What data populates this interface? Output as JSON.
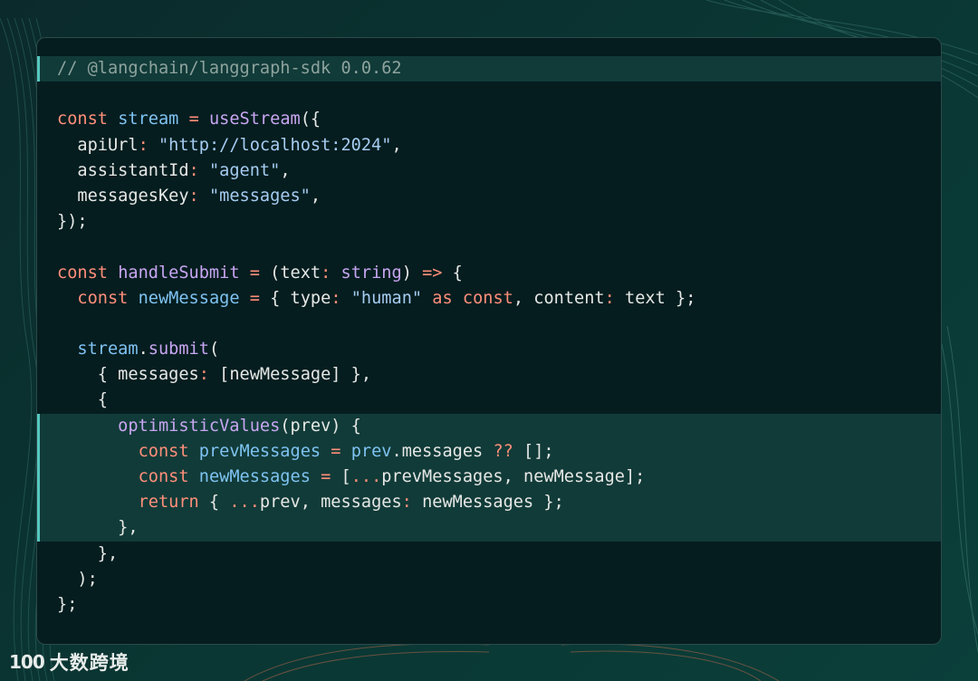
{
  "code_lines": [
    {
      "highlight": true,
      "tokens": [
        {
          "t": "// @langchain/langgraph-sdk 0.0.62",
          "c": "com"
        }
      ]
    },
    {
      "highlight": false,
      "tokens": []
    },
    {
      "highlight": false,
      "tokens": [
        {
          "t": "const",
          "c": "kw"
        },
        {
          "t": " ",
          "c": "pun"
        },
        {
          "t": "stream",
          "c": "var"
        },
        {
          "t": " ",
          "c": "pun"
        },
        {
          "t": "=",
          "c": "op"
        },
        {
          "t": " ",
          "c": "pun"
        },
        {
          "t": "useStream",
          "c": "fn"
        },
        {
          "t": "({",
          "c": "pun"
        }
      ]
    },
    {
      "highlight": false,
      "tokens": [
        {
          "t": "  apiUrl",
          "c": "prop"
        },
        {
          "t": ":",
          "c": "op"
        },
        {
          "t": " ",
          "c": "pun"
        },
        {
          "t": "\"http://localhost:2024\"",
          "c": "str"
        },
        {
          "t": ",",
          "c": "pun"
        }
      ]
    },
    {
      "highlight": false,
      "tokens": [
        {
          "t": "  assistantId",
          "c": "prop"
        },
        {
          "t": ":",
          "c": "op"
        },
        {
          "t": " ",
          "c": "pun"
        },
        {
          "t": "\"agent\"",
          "c": "str"
        },
        {
          "t": ",",
          "c": "pun"
        }
      ]
    },
    {
      "highlight": false,
      "tokens": [
        {
          "t": "  messagesKey",
          "c": "prop"
        },
        {
          "t": ":",
          "c": "op"
        },
        {
          "t": " ",
          "c": "pun"
        },
        {
          "t": "\"messages\"",
          "c": "str"
        },
        {
          "t": ",",
          "c": "pun"
        }
      ]
    },
    {
      "highlight": false,
      "tokens": [
        {
          "t": "});",
          "c": "pun"
        }
      ]
    },
    {
      "highlight": false,
      "tokens": []
    },
    {
      "highlight": false,
      "tokens": [
        {
          "t": "const",
          "c": "kw"
        },
        {
          "t": " ",
          "c": "pun"
        },
        {
          "t": "handleSubmit",
          "c": "fn"
        },
        {
          "t": " ",
          "c": "pun"
        },
        {
          "t": "=",
          "c": "op"
        },
        {
          "t": " (",
          "c": "pun"
        },
        {
          "t": "text",
          "c": "prop"
        },
        {
          "t": ":",
          "c": "op"
        },
        {
          "t": " ",
          "c": "pun"
        },
        {
          "t": "string",
          "c": "type"
        },
        {
          "t": ") ",
          "c": "pun"
        },
        {
          "t": "=>",
          "c": "op"
        },
        {
          "t": " {",
          "c": "pun"
        }
      ]
    },
    {
      "highlight": false,
      "tokens": [
        {
          "t": "  ",
          "c": "pun"
        },
        {
          "t": "const",
          "c": "kw"
        },
        {
          "t": " ",
          "c": "pun"
        },
        {
          "t": "newMessage",
          "c": "var"
        },
        {
          "t": " ",
          "c": "pun"
        },
        {
          "t": "=",
          "c": "op"
        },
        {
          "t": " { ",
          "c": "pun"
        },
        {
          "t": "type",
          "c": "prop"
        },
        {
          "t": ":",
          "c": "op"
        },
        {
          "t": " ",
          "c": "pun"
        },
        {
          "t": "\"human\"",
          "c": "str"
        },
        {
          "t": " ",
          "c": "pun"
        },
        {
          "t": "as",
          "c": "kw"
        },
        {
          "t": " ",
          "c": "pun"
        },
        {
          "t": "const",
          "c": "kw"
        },
        {
          "t": ", ",
          "c": "pun"
        },
        {
          "t": "content",
          "c": "prop"
        },
        {
          "t": ":",
          "c": "op"
        },
        {
          "t": " ",
          "c": "pun"
        },
        {
          "t": "text",
          "c": "prop"
        },
        {
          "t": " };",
          "c": "pun"
        }
      ]
    },
    {
      "highlight": false,
      "tokens": []
    },
    {
      "highlight": false,
      "tokens": [
        {
          "t": "  ",
          "c": "pun"
        },
        {
          "t": "stream",
          "c": "var"
        },
        {
          "t": ".",
          "c": "pun"
        },
        {
          "t": "submit",
          "c": "fn"
        },
        {
          "t": "(",
          "c": "pun"
        }
      ]
    },
    {
      "highlight": false,
      "tokens": [
        {
          "t": "    { ",
          "c": "pun"
        },
        {
          "t": "messages",
          "c": "prop"
        },
        {
          "t": ":",
          "c": "op"
        },
        {
          "t": " [",
          "c": "pun"
        },
        {
          "t": "newMessage",
          "c": "prop"
        },
        {
          "t": "] },",
          "c": "pun"
        }
      ]
    },
    {
      "highlight": false,
      "tokens": [
        {
          "t": "    {",
          "c": "pun"
        }
      ]
    },
    {
      "highlight": true,
      "tokens": [
        {
          "t": "      ",
          "c": "pun"
        },
        {
          "t": "optimisticValues",
          "c": "fn"
        },
        {
          "t": "(",
          "c": "pun"
        },
        {
          "t": "prev",
          "c": "prop"
        },
        {
          "t": ") {",
          "c": "pun"
        }
      ]
    },
    {
      "highlight": true,
      "tokens": [
        {
          "t": "        ",
          "c": "pun"
        },
        {
          "t": "const",
          "c": "kw"
        },
        {
          "t": " ",
          "c": "pun"
        },
        {
          "t": "prevMessages",
          "c": "var"
        },
        {
          "t": " ",
          "c": "pun"
        },
        {
          "t": "=",
          "c": "op"
        },
        {
          "t": " ",
          "c": "pun"
        },
        {
          "t": "prev",
          "c": "var"
        },
        {
          "t": ".",
          "c": "pun"
        },
        {
          "t": "messages",
          "c": "prop"
        },
        {
          "t": " ",
          "c": "pun"
        },
        {
          "t": "??",
          "c": "op"
        },
        {
          "t": " [];",
          "c": "pun"
        }
      ]
    },
    {
      "highlight": true,
      "tokens": [
        {
          "t": "        ",
          "c": "pun"
        },
        {
          "t": "const",
          "c": "kw"
        },
        {
          "t": " ",
          "c": "pun"
        },
        {
          "t": "newMessages",
          "c": "var"
        },
        {
          "t": " ",
          "c": "pun"
        },
        {
          "t": "=",
          "c": "op"
        },
        {
          "t": " [",
          "c": "pun"
        },
        {
          "t": "...",
          "c": "op"
        },
        {
          "t": "prevMessages",
          "c": "prop"
        },
        {
          "t": ", ",
          "c": "pun"
        },
        {
          "t": "newMessage",
          "c": "prop"
        },
        {
          "t": "];",
          "c": "pun"
        }
      ]
    },
    {
      "highlight": true,
      "tokens": [
        {
          "t": "        ",
          "c": "pun"
        },
        {
          "t": "return",
          "c": "kw"
        },
        {
          "t": " { ",
          "c": "pun"
        },
        {
          "t": "...",
          "c": "op"
        },
        {
          "t": "prev",
          "c": "prop"
        },
        {
          "t": ", ",
          "c": "pun"
        },
        {
          "t": "messages",
          "c": "prop"
        },
        {
          "t": ":",
          "c": "op"
        },
        {
          "t": " ",
          "c": "pun"
        },
        {
          "t": "newMessages",
          "c": "prop"
        },
        {
          "t": " };",
          "c": "pun"
        }
      ]
    },
    {
      "highlight": true,
      "tokens": [
        {
          "t": "      },",
          "c": "pun"
        }
      ]
    },
    {
      "highlight": false,
      "tokens": [
        {
          "t": "    },",
          "c": "pun"
        }
      ]
    },
    {
      "highlight": false,
      "tokens": [
        {
          "t": "  );",
          "c": "pun"
        }
      ]
    },
    {
      "highlight": false,
      "tokens": [
        {
          "t": "};",
          "c": "pun"
        }
      ]
    }
  ],
  "watermark": {
    "logo": "100",
    "text": "大数跨境"
  },
  "colors": {
    "background": "#0a3532",
    "card": "#051d1f",
    "highlight_bar": "#55c8bf",
    "keyword": "#ff8f7a",
    "function": "#c8a6f2",
    "variable": "#7fc3f2",
    "string": "#a6ccf2",
    "comment": "#8ea39f"
  }
}
